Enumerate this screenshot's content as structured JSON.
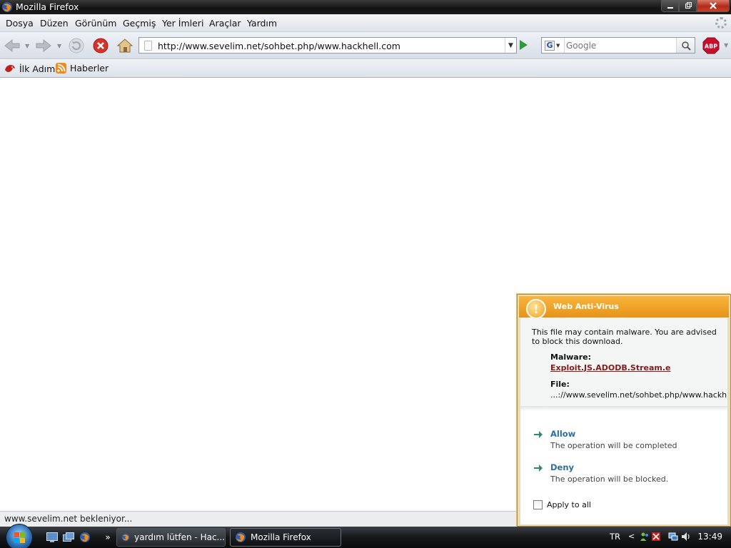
{
  "window": {
    "title": "Mozilla Firefox"
  },
  "menu": [
    "Dosya",
    "Düzen",
    "Görünüm",
    "Geçmiş",
    "Yer İmleri",
    "Araçlar",
    "Yardım"
  ],
  "nav": {
    "url": "http://www.sevelim.net/sohbet.php/www.hackhell.com",
    "search_placeholder": "Google",
    "search_engine_letter": "G",
    "abp_label": "ABP"
  },
  "bookmarks": [
    "İlk Adım",
    "Haberler"
  ],
  "status": {
    "text": "www.sevelim.net bekleniyor..."
  },
  "antivirus": {
    "title": "Web Anti-Virus",
    "alert_glyph": "!",
    "message": "This file may contain malware. You are advised to block this download.",
    "malware_label": "Malware:",
    "malware_name": "Exploit.JS.ADODB.Stream.e",
    "file_label": "File:",
    "file_value": "...://www.sevelim.net/sohbet.php/www.hackh...",
    "actions": [
      {
        "title": "Allow",
        "desc": "The operation will be completed"
      },
      {
        "title": "Deny",
        "desc": "The operation will be blocked."
      }
    ],
    "apply_all": "Apply to all"
  },
  "taskbar": {
    "overflow": "»",
    "buttons": [
      "yardım lütfen - Hac...",
      "Mozilla Firefox"
    ],
    "lang": "TR",
    "tray_chevron": "<",
    "clock": "13:49"
  },
  "colors": {
    "av_header": "#e7931a",
    "av_link": "#2a6fa0",
    "malware_text": "#8a1a1a",
    "go_button": "#2f9a3a",
    "abp_red": "#c8102e"
  }
}
